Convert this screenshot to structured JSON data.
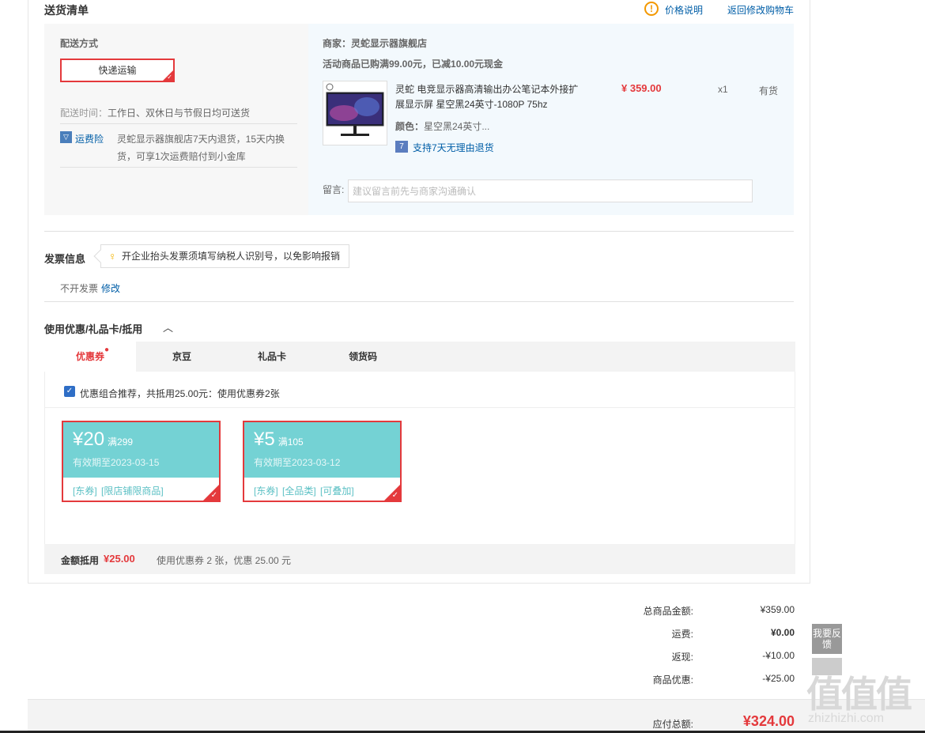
{
  "section": {
    "title": "送货清单",
    "price_note": "价格说明",
    "back_to_cart": "返回修改购物车"
  },
  "shipping": {
    "method_label": "配送方式",
    "method_value": "快递运输",
    "time_label": "配送时间：",
    "time_value": "工作日、双休日与节假日均可送货",
    "insurance_label": "运费险",
    "insurance_desc_line1": "灵蛇显示器旗舰店7天内退货，15天内换",
    "insurance_desc_line2": "货，可享1次运费赔付到小金库"
  },
  "merchant": {
    "store": "商家：灵蛇显示器旗舰店",
    "promotion": "活动商品已购满99.00元，已减10.00元现金",
    "product_name_line1": "灵蛇 电竞显示器高清输出办公笔记本外接扩",
    "product_name_line2": "展显示屏 星空黑24英寸-1080P 75hz",
    "price": "¥ 359.00",
    "qty": "x1",
    "stock": "有货",
    "color_label": "颜色：",
    "color_value": "星空黑24英寸...",
    "return_policy": "支持7天无理由退货",
    "note_label": "留言:",
    "note_placeholder": "建议留言前先与商家沟通确认"
  },
  "invoice": {
    "title": "发票信息",
    "tip": "开企业抬头发票须填写纳税人识别号，以免影响报销",
    "value": "不开发票",
    "edit": "修改"
  },
  "discount": {
    "title": "使用优惠/礼品卡/抵用",
    "tabs": [
      "优惠券",
      "京豆",
      "礼品卡",
      "领货码"
    ],
    "combo_text": "优惠组合推荐，共抵用25.00元：使用优惠券2张",
    "coupons": [
      {
        "amount": "¥20",
        "condition": "满299",
        "expiry": "有效期至2023-03-15",
        "tags": "[东券]  [限店铺限商品]"
      },
      {
        "amount": "¥5",
        "condition": "满105",
        "expiry": "有效期至2023-03-12",
        "tags": "[东券]  [全品类]  [可叠加]"
      }
    ],
    "sum_label": "金额抵用",
    "sum_value": "¥25.00",
    "sum_desc": "使用优惠券 2 张，优惠 25.00 元"
  },
  "totals": {
    "rows": [
      {
        "label": "总商品金额:",
        "value": "¥359.00"
      },
      {
        "label": "运费:",
        "value": "¥0.00"
      },
      {
        "label": "返现:",
        "value": "-¥10.00"
      },
      {
        "label": "商品优惠:",
        "value": "-¥25.00"
      }
    ],
    "payable_label": "应付总额:",
    "payable_value": "¥324.00"
  },
  "feedback": "我要反馈",
  "watermark": {
    "logo": "值值值",
    "site": "zhizhizhi.com"
  },
  "colors": {
    "accent_red": "#e4393c",
    "link_blue": "#005ea7",
    "coupon_teal": "#74d2d4"
  }
}
